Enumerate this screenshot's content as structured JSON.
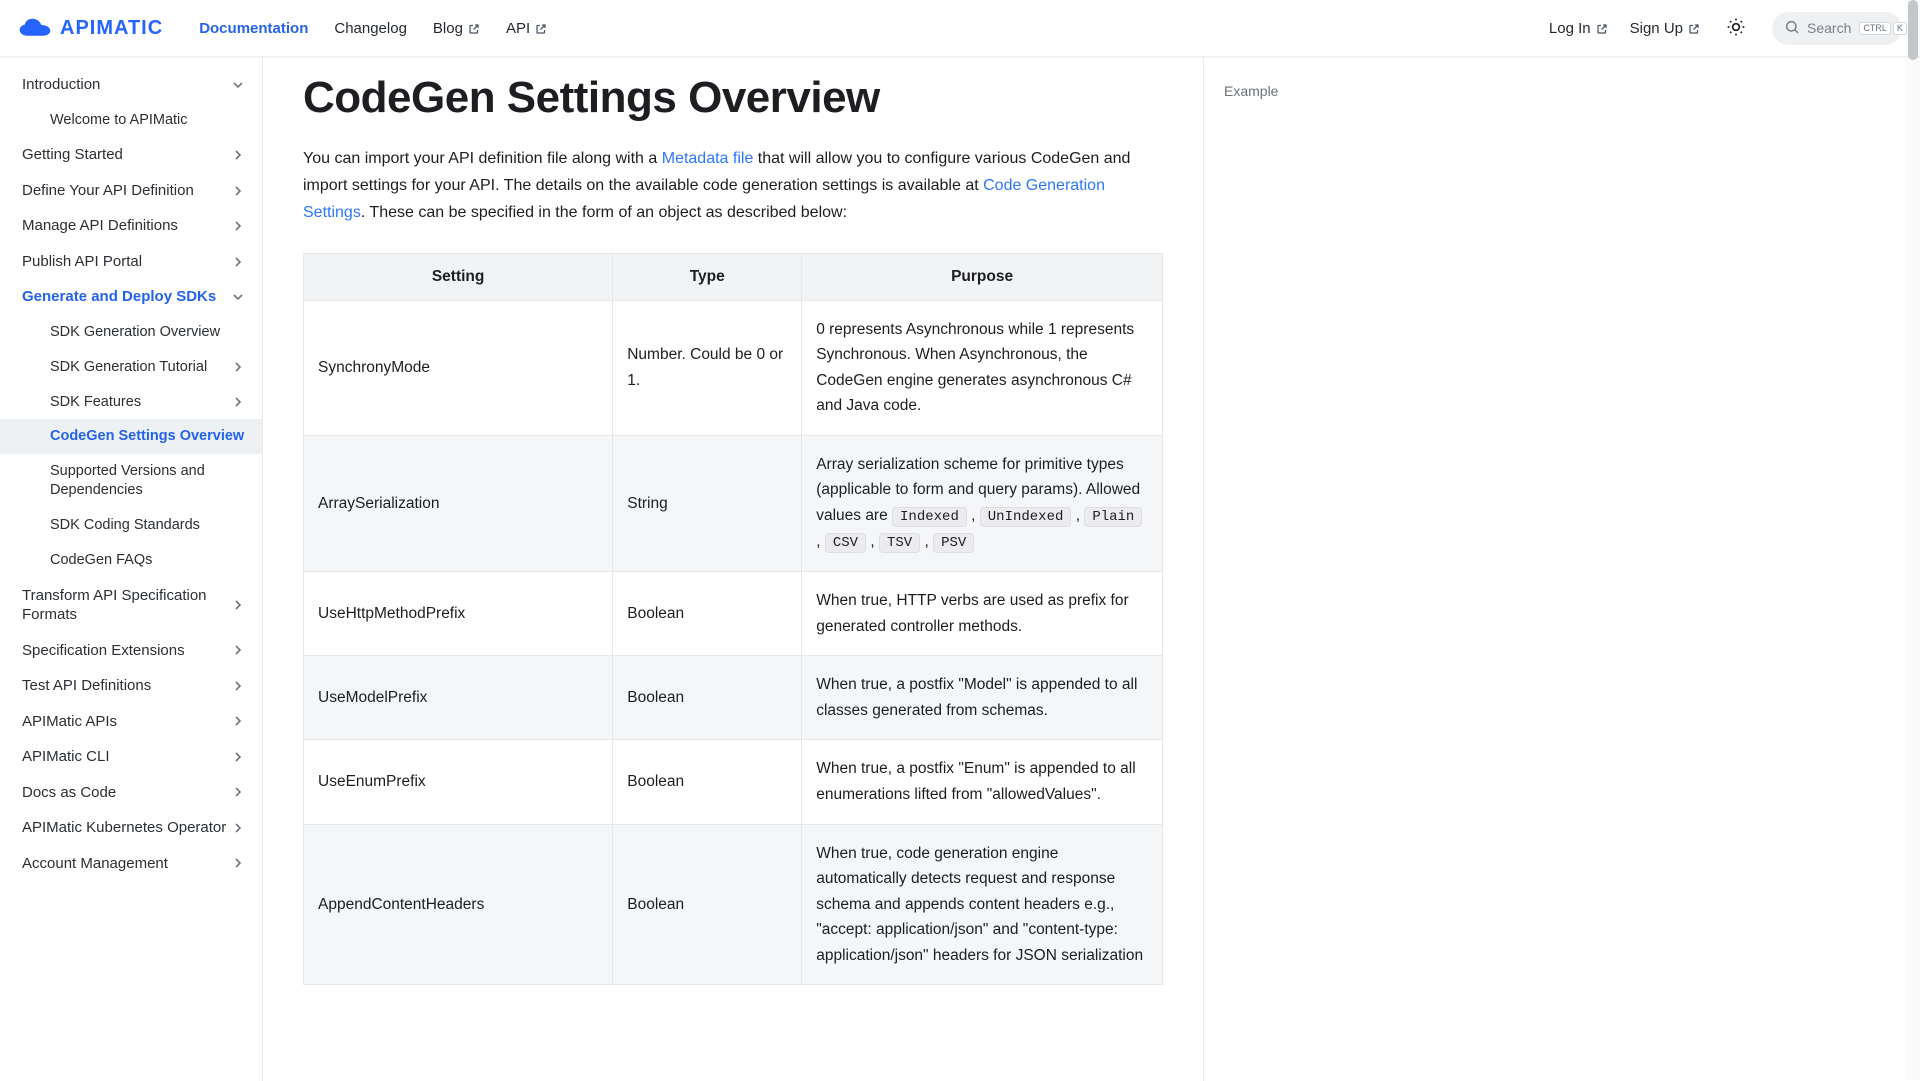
{
  "brand": {
    "text": "APIMATIC"
  },
  "nav": {
    "documentation": "Documentation",
    "changelog": "Changelog",
    "blog": "Blog",
    "api": "API",
    "login": "Log In",
    "signup": "Sign Up",
    "search_placeholder": "Search",
    "kbd1": "CTRL",
    "kbd2": "K"
  },
  "sidebar": {
    "items": [
      {
        "label": "Introduction",
        "expand": "down",
        "children": [
          {
            "label": "Welcome to APIMatic"
          }
        ]
      },
      {
        "label": "Getting Started",
        "expand": "right"
      },
      {
        "label": "Define Your API Definition",
        "expand": "right"
      },
      {
        "label": "Manage API Definitions",
        "expand": "right"
      },
      {
        "label": "Publish API Portal",
        "expand": "right"
      },
      {
        "label": "Generate and Deploy SDKs",
        "expand": "down",
        "accent": true,
        "children": [
          {
            "label": "SDK Generation Overview"
          },
          {
            "label": "SDK Generation Tutorial",
            "expand": "right"
          },
          {
            "label": "SDK Features",
            "expand": "right"
          },
          {
            "label": "CodeGen Settings Overview",
            "active": true
          },
          {
            "label": "Supported Versions and Dependencies"
          },
          {
            "label": "SDK Coding Standards"
          },
          {
            "label": "CodeGen FAQs"
          }
        ]
      },
      {
        "label": "Transform API Specification Formats",
        "expand": "right"
      },
      {
        "label": "Specification Extensions",
        "expand": "right"
      },
      {
        "label": "Test API Definitions",
        "expand": "right"
      },
      {
        "label": "APIMatic APIs",
        "expand": "right"
      },
      {
        "label": "APIMatic CLI",
        "expand": "right"
      },
      {
        "label": "Docs as Code",
        "expand": "right"
      },
      {
        "label": "APIMatic Kubernetes Operator",
        "expand": "right"
      },
      {
        "label": "Account Management",
        "expand": "right"
      }
    ]
  },
  "page": {
    "title": "CodeGen Settings Overview",
    "intro_pre": "You can import your API definition file along with a ",
    "intro_link1": "Metadata file",
    "intro_mid": " that will allow you to configure various CodeGen and import settings for your API. The details on the available code generation settings is available at ",
    "intro_link2": "Code Generation Settings",
    "intro_post": ". These can be specified in the form of an object as described below:",
    "table": {
      "head": {
        "c1": "Setting",
        "c2": "Type",
        "c3": "Purpose"
      },
      "rows": [
        {
          "setting": "SynchronyMode",
          "type": "Number. Could be 0 or 1.",
          "purpose_plain": "0 represents Asynchronous while 1 represents Synchronous. When Asynchronous, the CodeGen engine generates asynchronous C# and Java code."
        },
        {
          "setting": "ArraySerialization",
          "type": "String",
          "purpose_pre": "Array serialization scheme for primitive types (applicable to form and query params). Allowed values are ",
          "codes": [
            "Indexed",
            "UnIndexed",
            "Plain",
            "CSV",
            "TSV",
            "PSV"
          ]
        },
        {
          "setting": "UseHttpMethodPrefix",
          "type": "Boolean",
          "purpose_plain": "When true, HTTP verbs are used as prefix for generated controller methods."
        },
        {
          "setting": "UseModelPrefix",
          "type": "Boolean",
          "purpose_plain": "When true, a postfix \"Model\" is appended to all classes generated from schemas."
        },
        {
          "setting": "UseEnumPrefix",
          "type": "Boolean",
          "purpose_plain": "When true, a postfix \"Enum\" is appended to all enumerations lifted from \"allowedValues\"."
        },
        {
          "setting": "AppendContentHeaders",
          "type": "Boolean",
          "purpose_plain": "When true, code generation engine automatically detects request and response schema and appends content headers e.g., \"accept: application/json\" and \"content-type: application/json\" headers for JSON serialization"
        }
      ]
    }
  },
  "toc": {
    "item1": "Example"
  }
}
